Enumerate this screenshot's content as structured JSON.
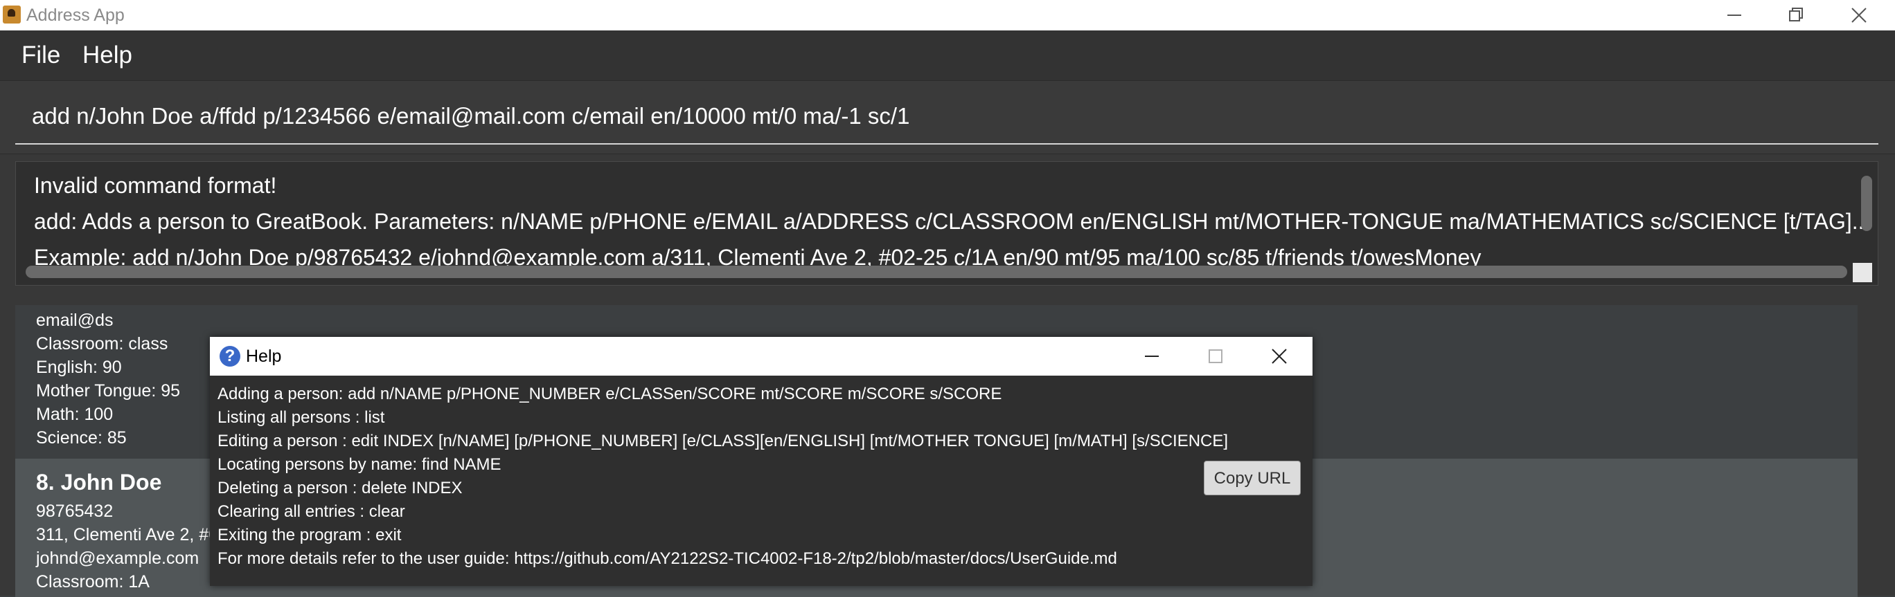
{
  "window": {
    "title": "Address App"
  },
  "menu": {
    "file": "File",
    "help": "Help"
  },
  "command": {
    "value": "add n/John Doe a/ffdd p/1234566 e/email@mail.com c/email en/10000 mt/0 ma/-1 sc/1"
  },
  "result": {
    "line1": "Invalid command format!",
    "line2": "add: Adds a person to GreatBook. Parameters: n/NAME p/PHONE e/EMAIL a/ADDRESS c/CLASSROOM en/ENGLISH mt/MOTHER-TONGUE ma/MATHEMATICS sc/SCIENCE [t/TAG]...",
    "line3": "Example: add n/John Doe p/98765432 e/johnd@example.com a/311, Clementi Ave 2, #02-25 c/1A en/90 mt/95 ma/100 sc/85 t/friends t/owesMoney"
  },
  "persons": [
    {
      "email": "email@ds",
      "classroom": "Classroom: class",
      "english": "English: 90",
      "mother_tongue": "Mother Tongue: 95",
      "math": "Math: 100",
      "science": "Science: 85"
    },
    {
      "title": "8.  John Doe",
      "phone": "98765432",
      "address": "311, Clementi Ave 2, #02-25",
      "email": "johnd@example.com",
      "classroom": "Classroom: 1A"
    }
  ],
  "help_dialog": {
    "title": "Help",
    "lines": [
      "Adding a person: add n/NAME p/PHONE_NUMBER e/CLASSen/SCORE mt/SCORE m/SCORE s/SCORE",
      "Listing all persons : list",
      "Editing a person : edit INDEX [n/NAME] [p/PHONE_NUMBER] [e/CLASS][en/ENGLISH] [mt/MOTHER TONGUE] [m/MATH] [s/SCIENCE]",
      "Locating persons by name: find NAME",
      "Deleting a person : delete INDEX",
      "Clearing all entries : clear",
      "Exiting the program : exit",
      "For more details refer to the user guide: https://github.com/AY2122S2-TIC4002-F18-2/tp2/blob/master/docs/UserGuide.md"
    ],
    "copy_button": "Copy URL"
  },
  "colors": {
    "background": "#3c3f41",
    "selected_card": "#515658",
    "help_body": "#2f2f2f"
  }
}
